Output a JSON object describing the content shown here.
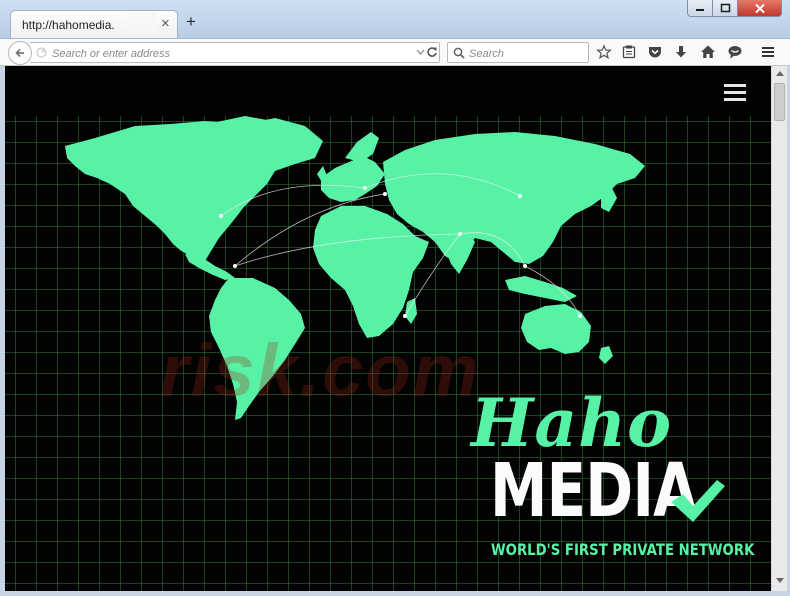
{
  "browser": {
    "tab": {
      "title": "http://hahomedia.",
      "close_glyph": "×"
    },
    "new_tab_glyph": "+",
    "address": {
      "placeholder": "Search or enter address",
      "value": ""
    },
    "search": {
      "placeholder": "Search",
      "value": ""
    },
    "toolbar_icons": [
      "bookmark-star-icon",
      "reading-list-icon",
      "pocket-icon",
      "download-icon",
      "home-icon",
      "chat-icon",
      "menu-icon"
    ],
    "window_buttons": [
      "minimize",
      "maximize",
      "close"
    ]
  },
  "page": {
    "background_color": "#020202",
    "grid_color": "#28783a",
    "map_color": "#57f2a6",
    "logo": {
      "script_text": "Haho",
      "main_text": "MEDIA",
      "tagline": "WORLD'S FIRST PRIVATE NETWORK",
      "accent_color": "#57f2a6",
      "main_color": "#fbfbfb"
    },
    "watermark": "risk.com"
  }
}
